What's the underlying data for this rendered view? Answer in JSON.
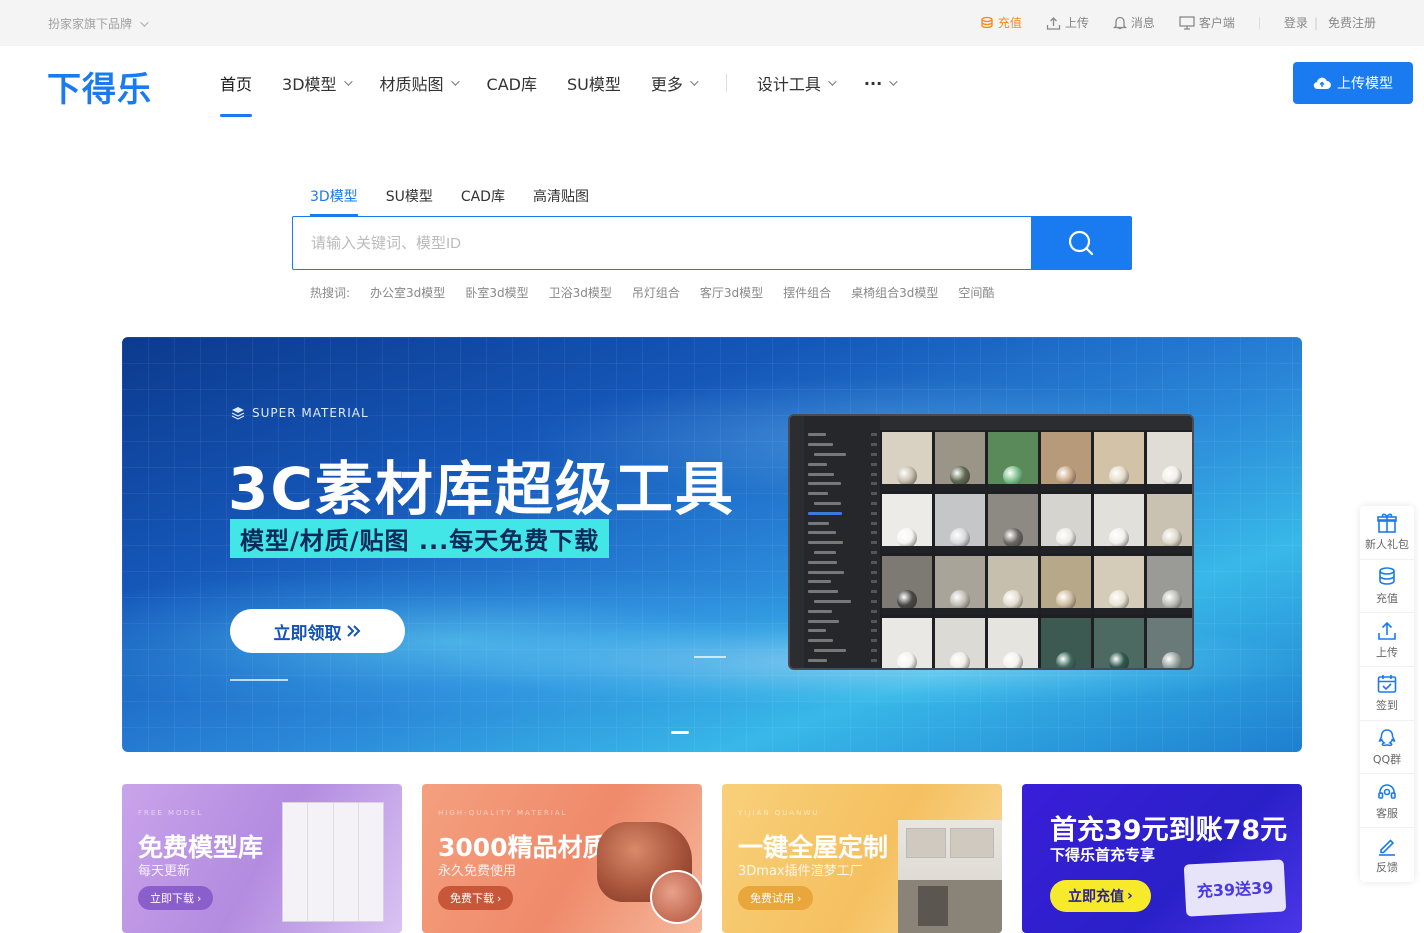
{
  "topbar": {
    "brand_text": "扮家家旗下品牌",
    "recharge": "充值",
    "upload": "上传",
    "messages": "消息",
    "client": "客户端",
    "login": "登录",
    "separator": "|",
    "register": "免费注册"
  },
  "header": {
    "logo": "下得乐",
    "nav": [
      {
        "label": "首页"
      },
      {
        "label": "3D模型"
      },
      {
        "label": "材质贴图"
      },
      {
        "label": "CAD库"
      },
      {
        "label": "SU模型"
      },
      {
        "label": "更多"
      },
      {
        "label": "设计工具"
      },
      {
        "label": "···"
      }
    ],
    "upload_button": "上传模型"
  },
  "search": {
    "tabs": [
      "3D模型",
      "SU模型",
      "CAD库",
      "高清贴图"
    ],
    "placeholder": "请输入关键词、模型ID",
    "hot_label": "热搜词:",
    "hot_words": [
      "办公室3d模型",
      "卧室3d模型",
      "卫浴3d模型",
      "吊灯组合",
      "客厅3d模型",
      "摆件组合",
      "桌椅组合3d模型",
      "空间酷"
    ]
  },
  "hero": {
    "brand_mark": "SUPER MATERIAL",
    "title": "3C素材库超级工具",
    "subtitle": "模型/材质/贴图 ...每天免费下载",
    "cta": "立即领取"
  },
  "cards": [
    {
      "kicker": "FREE MODEL",
      "title": "免费模型库",
      "subtitle": "每天更新",
      "button": "立即下载"
    },
    {
      "kicker": "HIGH-QUALITY MATERIAL",
      "title": "3000精品材质",
      "subtitle": "永久免费使用",
      "button": "免费下载"
    },
    {
      "kicker": "YIJIAN QUANWU",
      "title": "一键全屋定制",
      "subtitle": "3Dmax插件渲梦工厂",
      "button": "免费试用"
    },
    {
      "title": "首充39元到账78元",
      "subtitle": "下得乐首充专享",
      "button": "立即充值",
      "coupon": "充39送39"
    }
  ],
  "sidebar": [
    {
      "label": "新人礼包",
      "icon": "gift-icon"
    },
    {
      "label": "充值",
      "icon": "coins-icon"
    },
    {
      "label": "上传",
      "icon": "upload-icon"
    },
    {
      "label": "签到",
      "icon": "calendar-check-icon"
    },
    {
      "label": "QQ群",
      "icon": "qq-icon"
    },
    {
      "label": "客服",
      "icon": "headset-icon"
    },
    {
      "label": "反馈",
      "icon": "pen-icon"
    }
  ],
  "colors": {
    "accent": "#1a7bf0",
    "recharge": "#f08a1c"
  }
}
